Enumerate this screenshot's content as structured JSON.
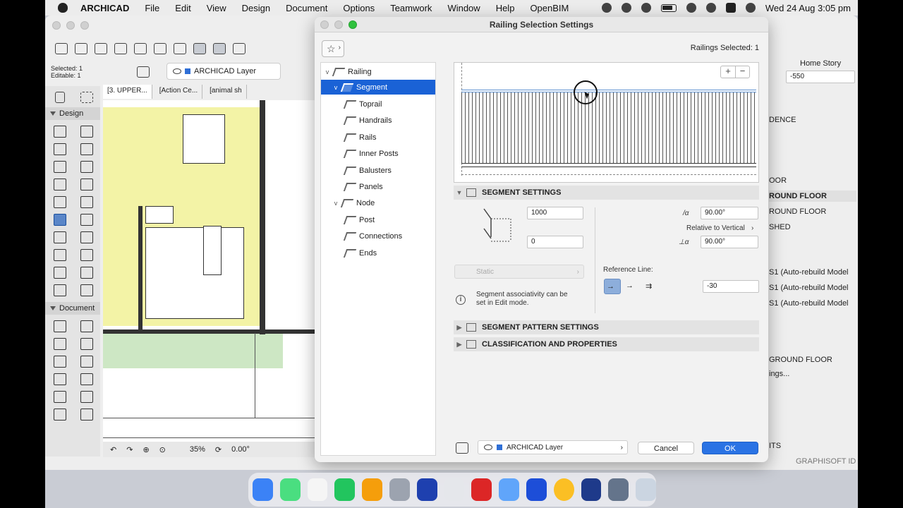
{
  "menubar": {
    "app_name": "ARCHICAD",
    "menus": [
      "File",
      "Edit",
      "View",
      "Design",
      "Document",
      "Options",
      "Teamwork",
      "Window",
      "Help",
      "OpenBIM"
    ],
    "clock": "Wed 24 Aug  3:05 pm"
  },
  "main_window": {
    "info_selected": "Selected: 1",
    "info_editable": "Editable: 1",
    "layer_name": "ARCHICAD Layer",
    "tabs": [
      "[3. UPPER...",
      "[Action Ce...",
      "[animal sh"
    ],
    "toolbox_sections": [
      "Design",
      "Document"
    ],
    "zoom": "35%",
    "angle": "0.00°"
  },
  "right_panel": {
    "story_label": "Home Story",
    "elevation": "-550",
    "items": [
      "DENCE",
      "OOR",
      "ROUND FLOOR",
      "ROUND FLOOR",
      "SHED",
      "S1 (Auto-rebuild Model",
      "S1 (Auto-rebuild Model",
      "S1 (Auto-rebuild Model",
      "GROUND FLOOR",
      "ings...",
      "ITS",
      "GRAPHISOFT ID"
    ]
  },
  "dialog": {
    "title": "Railing Selection Settings",
    "selection_count": "Railings Selected: 1",
    "tree": {
      "root": "Railing",
      "segment": "Segment",
      "segment_children": [
        "Toprail",
        "Handrails",
        "Rails",
        "Inner Posts",
        "Balusters",
        "Panels"
      ],
      "node": "Node",
      "node_children": [
        "Post",
        "Connections",
        "Ends"
      ]
    },
    "sections": {
      "segment_settings": "SEGMENT SETTINGS",
      "segment_pattern": "SEGMENT PATTERN SETTINGS",
      "classification": "CLASSIFICATION AND PROPERTIES"
    },
    "segment": {
      "height": "1000",
      "offset": "0",
      "angle_top": "90.00°",
      "relative_label": "Relative to Vertical",
      "angle_bottom": "90.00°",
      "static_label": "Static",
      "info_text_1": "Segment associativity can be",
      "info_text_2": "set in Edit mode.",
      "reference_label": "Reference Line:",
      "reference_offset": "-30"
    },
    "footer": {
      "layer": "ARCHICAD Layer",
      "cancel": "Cancel",
      "ok": "OK"
    }
  }
}
